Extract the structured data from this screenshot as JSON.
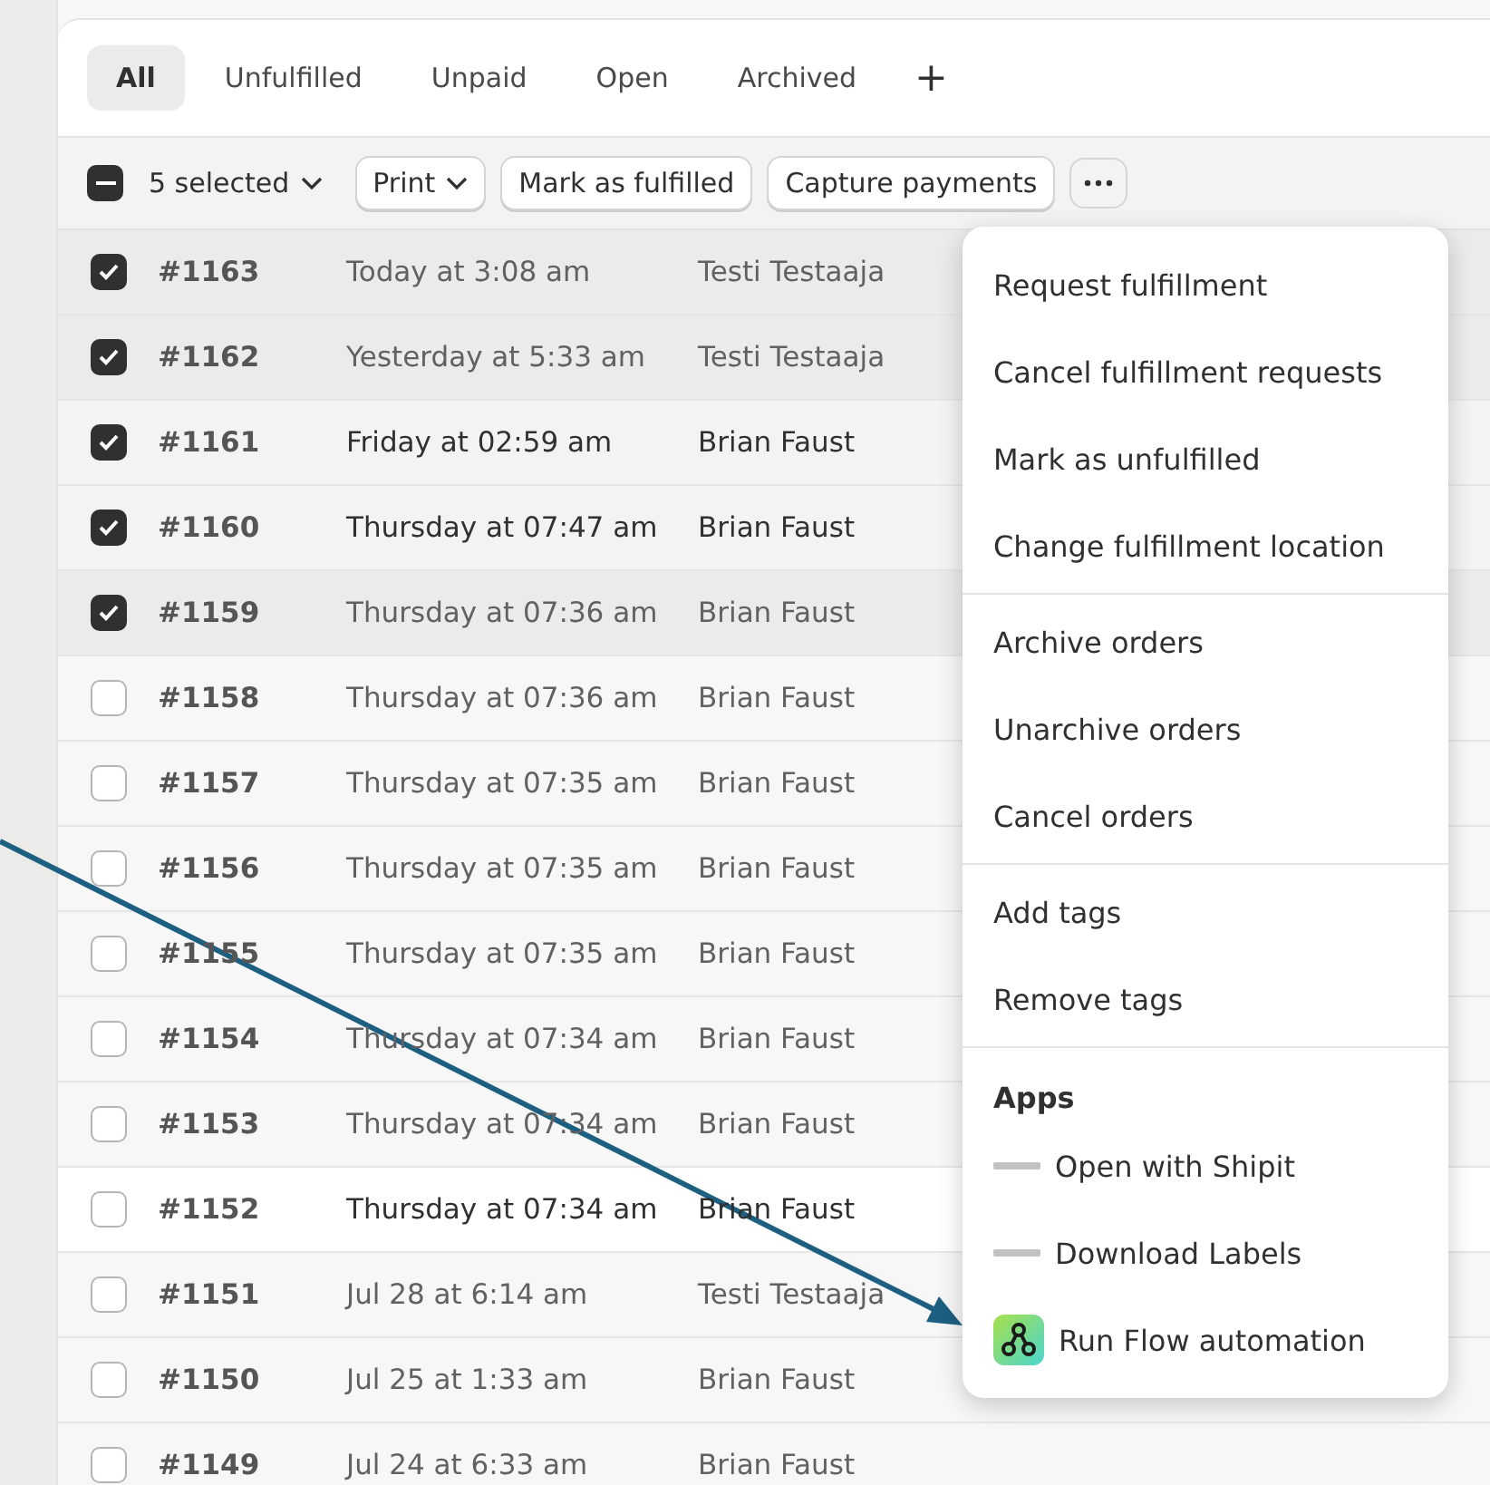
{
  "tabs": [
    {
      "label": "All",
      "selected": true
    },
    {
      "label": "Unfulfilled",
      "selected": false
    },
    {
      "label": "Unpaid",
      "selected": false
    },
    {
      "label": "Open",
      "selected": false
    },
    {
      "label": "Archived",
      "selected": false
    }
  ],
  "add_tab": "+",
  "bulk_bar": {
    "indeterminate": true,
    "selection": "5 selected",
    "buttons": [
      {
        "label": "Print",
        "dropdown": true
      },
      {
        "label": "Mark as fulfilled",
        "dropdown": false
      },
      {
        "label": "Capture payments",
        "dropdown": false
      }
    ]
  },
  "rows": [
    {
      "order": "#1163",
      "date": "Today at 3:08 am",
      "customer": "Testi Testaaja",
      "selected": true,
      "emphasized": false
    },
    {
      "order": "#1162",
      "date": "Yesterday at 5:33 am",
      "customer": "Testi Testaaja",
      "selected": true,
      "emphasized": false
    },
    {
      "order": "#1161",
      "date": "Friday at 02:59 am",
      "customer": "Brian Faust",
      "selected": true,
      "emphasized": true
    },
    {
      "order": "#1160",
      "date": "Thursday at 07:47 am",
      "customer": "Brian Faust",
      "selected": true,
      "emphasized": true
    },
    {
      "order": "#1159",
      "date": "Thursday at 07:36 am",
      "customer": "Brian Faust",
      "selected": true,
      "emphasized": false
    },
    {
      "order": "#1158",
      "date": "Thursday at 07:36 am",
      "customer": "Brian Faust",
      "selected": false,
      "emphasized": false
    },
    {
      "order": "#1157",
      "date": "Thursday at 07:35 am",
      "customer": "Brian Faust",
      "selected": false,
      "emphasized": false
    },
    {
      "order": "#1156",
      "date": "Thursday at 07:35 am",
      "customer": "Brian Faust",
      "selected": false,
      "emphasized": false
    },
    {
      "order": "#1155",
      "date": "Thursday at 07:35 am",
      "customer": "Brian Faust",
      "selected": false,
      "emphasized": false
    },
    {
      "order": "#1154",
      "date": "Thursday at 07:34 am",
      "customer": "Brian Faust",
      "selected": false,
      "emphasized": false
    },
    {
      "order": "#1153",
      "date": "Thursday at 07:34 am",
      "customer": "Brian Faust",
      "selected": false,
      "emphasized": false
    },
    {
      "order": "#1152",
      "date": "Thursday at 07:34 am",
      "customer": "Brian Faust",
      "selected": false,
      "emphasized": true
    },
    {
      "order": "#1151",
      "date": "Jul 28 at 6:14 am",
      "customer": "Testi Testaaja",
      "selected": false,
      "emphasized": false
    },
    {
      "order": "#1150",
      "date": "Jul 25 at 1:33 am",
      "customer": "Brian Faust",
      "selected": false,
      "emphasized": false
    },
    {
      "order": "#1149",
      "date": "Jul 24 at 6:33 am",
      "customer": "Brian Faust",
      "selected": false,
      "emphasized": false
    }
  ],
  "menu": {
    "sections": [
      {
        "items": [
          {
            "label": "Request fulfillment"
          },
          {
            "label": "Cancel fulfillment requests"
          },
          {
            "label": "Mark as unfulfilled"
          },
          {
            "label": "Change fulfillment location"
          }
        ]
      },
      {
        "items": [
          {
            "label": "Archive orders"
          },
          {
            "label": "Unarchive orders"
          },
          {
            "label": "Cancel orders"
          }
        ]
      },
      {
        "items": [
          {
            "label": "Add tags"
          },
          {
            "label": "Remove tags"
          }
        ]
      },
      {
        "title": "Apps",
        "items": [
          {
            "label": "Open with Shipit",
            "kind": "shipit"
          },
          {
            "label": "Download Labels",
            "kind": "shipit"
          },
          {
            "label": "Run Flow automation",
            "kind": "flow"
          }
        ]
      }
    ]
  }
}
